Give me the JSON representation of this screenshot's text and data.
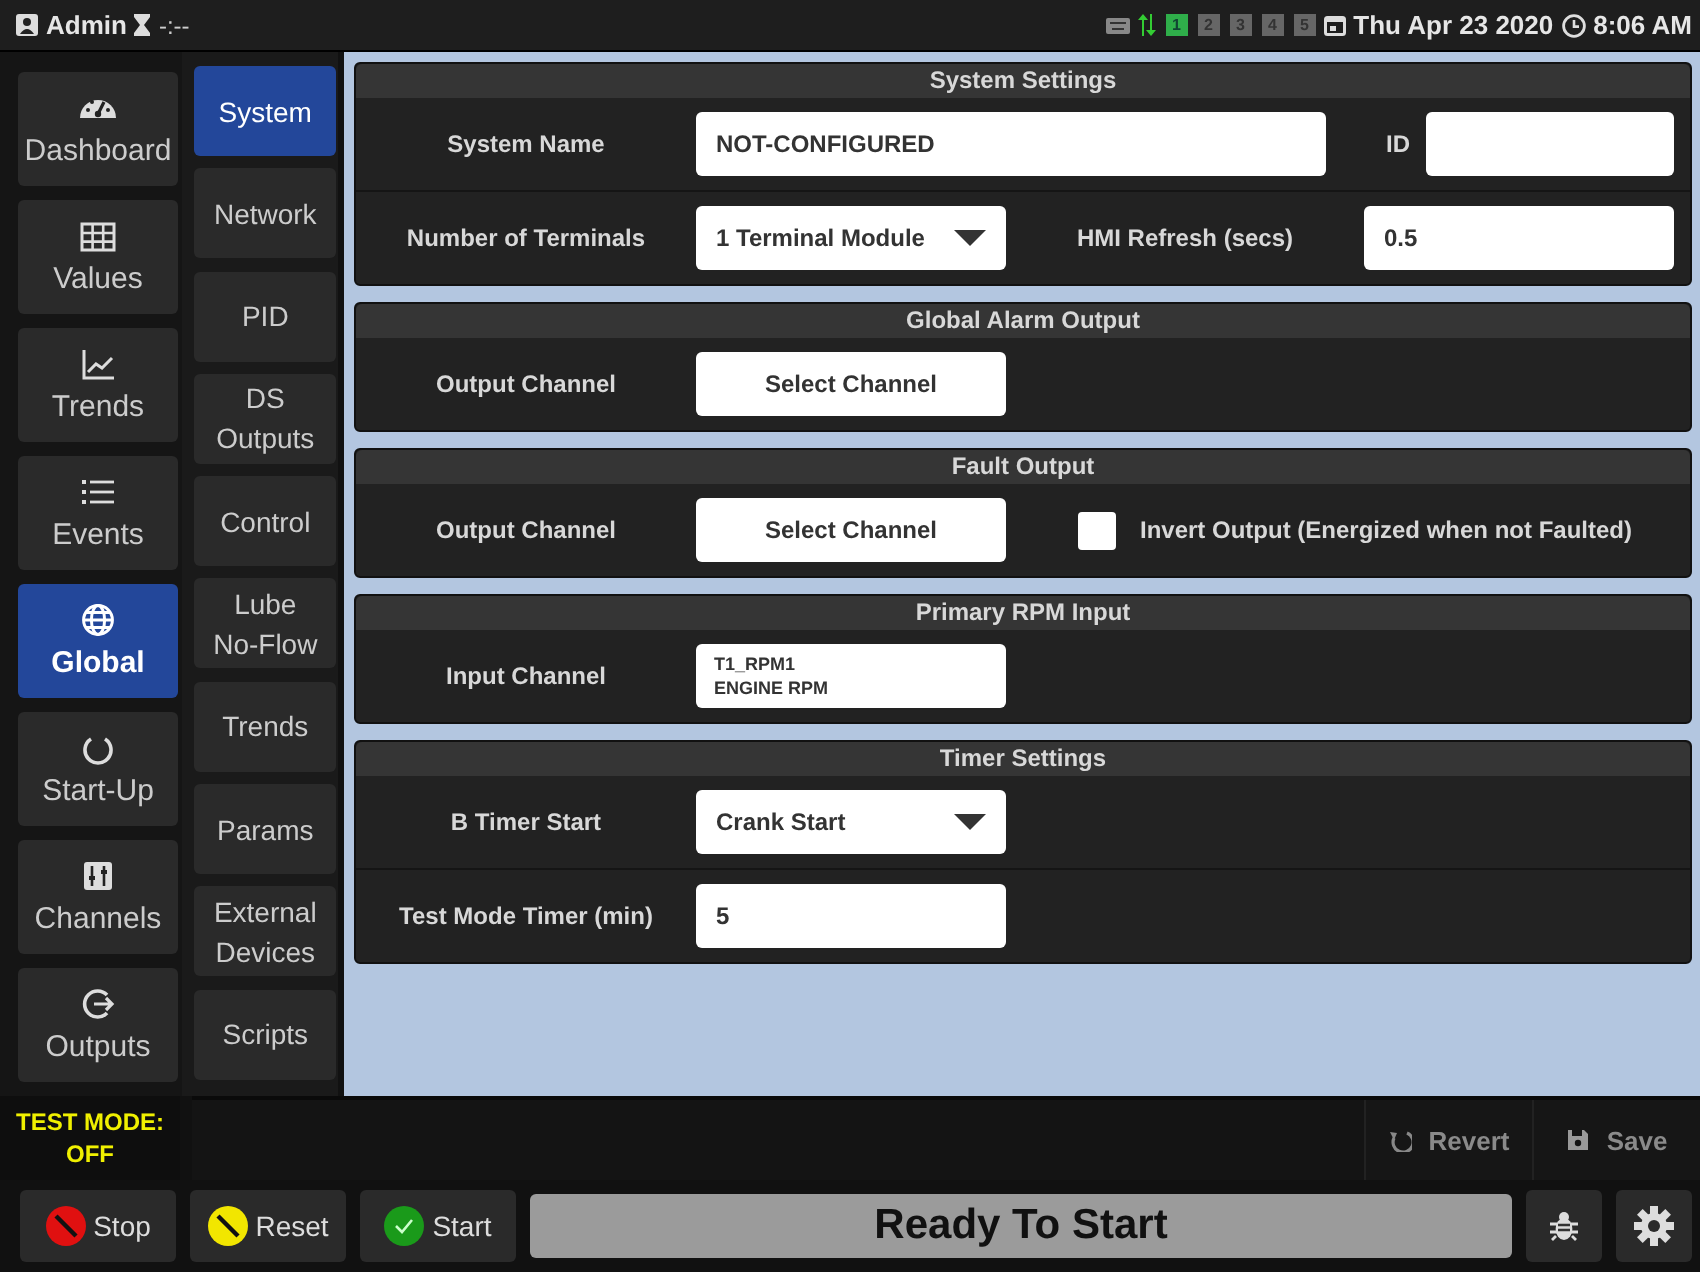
{
  "top_bar": {
    "user": "Admin",
    "timer": "-:--",
    "terminals": [
      {
        "label": "1",
        "on": true
      },
      {
        "label": "2",
        "on": false
      },
      {
        "label": "3",
        "on": false
      },
      {
        "label": "4",
        "on": false
      },
      {
        "label": "5",
        "on": false
      }
    ],
    "date": "Thu Apr 23 2020",
    "time": "8:06 AM"
  },
  "nav": [
    {
      "label": "Dashboard",
      "selected": false
    },
    {
      "label": "Values",
      "selected": false
    },
    {
      "label": "Trends",
      "selected": false
    },
    {
      "label": "Events",
      "selected": false
    },
    {
      "label": "Global",
      "selected": true
    },
    {
      "label": "Start-Up",
      "selected": false
    },
    {
      "label": "Channels",
      "selected": false
    },
    {
      "label": "Outputs",
      "selected": false
    }
  ],
  "subnav": [
    {
      "label": "System",
      "selected": true
    },
    {
      "label": "Network",
      "selected": false
    },
    {
      "label": "PID",
      "selected": false
    },
    {
      "label": "DS Outputs",
      "selected": false
    },
    {
      "label": "Control",
      "selected": false
    },
    {
      "label": "Lube No-Flow",
      "selected": false
    },
    {
      "label": "Trends",
      "selected": false
    },
    {
      "label": "Params",
      "selected": false
    },
    {
      "label": "External Devices",
      "selected": false
    },
    {
      "label": "Scripts",
      "selected": false
    }
  ],
  "sections": [
    {
      "title": "System Settings",
      "rows": [
        {
          "items": [
            {
              "kind": "label",
              "text": "System Name"
            },
            {
              "kind": "input",
              "value": "NOT-CONFIGURED"
            },
            {
              "kind": "label",
              "text": "ID"
            },
            {
              "kind": "input"
            }
          ]
        },
        {
          "items": [
            {
              "kind": "label",
              "text": "Number of Terminals"
            },
            {
              "kind": "select",
              "value": "1 Terminal Module"
            },
            {
              "kind": "label",
              "text": "HMI Refresh (secs)"
            },
            {
              "kind": "input",
              "value": "0.5"
            }
          ]
        }
      ]
    },
    {
      "title": "Global Alarm Output",
      "rows": [
        {
          "items": [
            {
              "kind": "label",
              "text": "Output Channel"
            },
            {
              "kind": "button",
              "text": "Select Channel"
            }
          ]
        }
      ]
    },
    {
      "title": "Fault Output",
      "rows": [
        {
          "items": [
            {
              "kind": "label",
              "text": "Output Channel"
            },
            {
              "kind": "button",
              "text": "Select Channel"
            },
            {
              "kind": "checkbox",
              "text": "Invert Output (Energized when not Faulted)",
              "checked": false
            }
          ]
        }
      ]
    },
    {
      "title": "Primary RPM Input",
      "rows": [
        {
          "items": [
            {
              "kind": "label",
              "text": "Input Channel"
            },
            {
              "kind": "channel",
              "lines": [
                "T1_RPM1",
                "ENGINE RPM"
              ]
            }
          ]
        }
      ]
    },
    {
      "title": "Timer Settings",
      "rows": [
        {
          "items": [
            {
              "kind": "label",
              "text": "B Timer Start"
            },
            {
              "kind": "select",
              "value": "Crank Start"
            }
          ]
        },
        {
          "items": [
            {
              "kind": "label",
              "text": "Test Mode Timer (min)"
            },
            {
              "kind": "input",
              "value": "5"
            }
          ]
        }
      ]
    }
  ],
  "test_mode": {
    "label": "TEST MODE:",
    "value": "OFF"
  },
  "actions": [
    {
      "label": "Revert",
      "disabled": true
    },
    {
      "label": "Save",
      "disabled": true
    }
  ],
  "controls": [
    {
      "label": "Stop"
    },
    {
      "label": "Reset"
    },
    {
      "label": "Start"
    }
  ],
  "status": "Ready To Start"
}
